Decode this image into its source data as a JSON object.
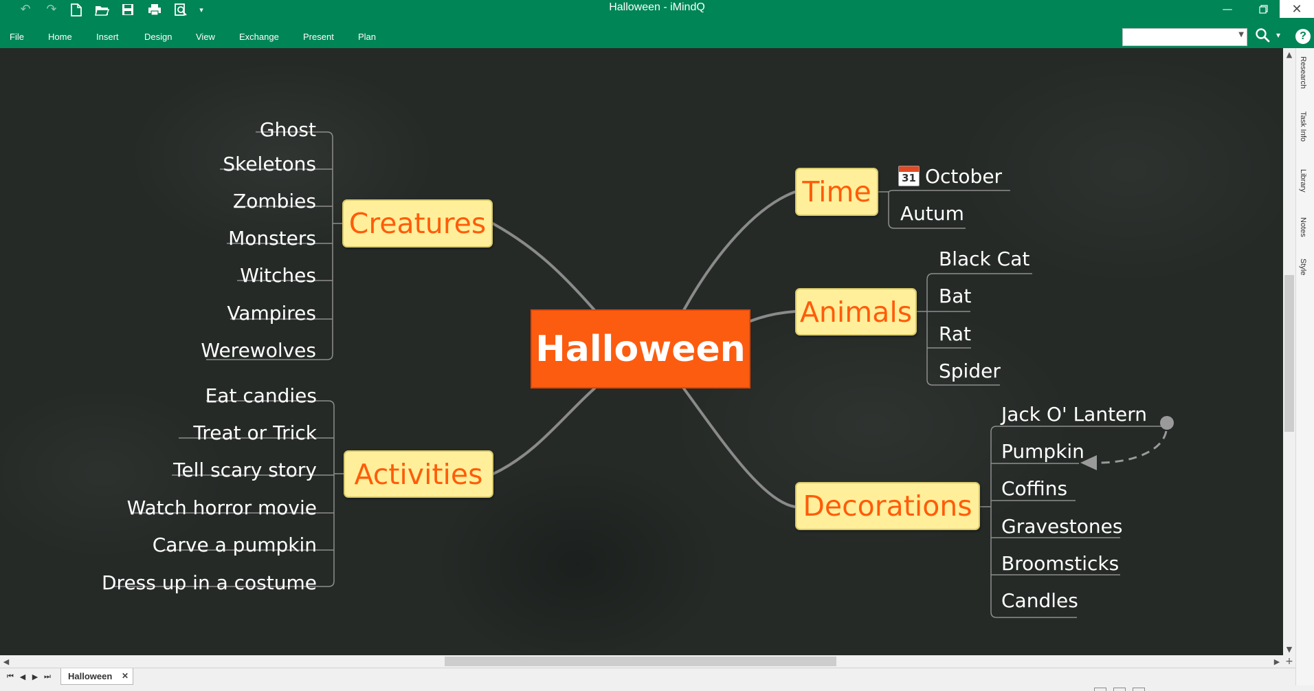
{
  "window": {
    "title": "Halloween - iMindQ"
  },
  "ribbon": {
    "tabs": [
      "File",
      "Home",
      "Insert",
      "Design",
      "View",
      "Exchange",
      "Present",
      "Plan"
    ]
  },
  "search": {
    "value": "",
    "placeholder": ""
  },
  "side_panel": {
    "tabs": [
      "Research",
      "Task Info",
      "Library",
      "Notes",
      "Style"
    ]
  },
  "map": {
    "central": "Halloween",
    "creatures": {
      "label": "Creatures",
      "items": [
        "Ghost",
        "Skeletons",
        "Zombies",
        "Monsters",
        "Witches",
        "Vampires",
        "Werewolves"
      ]
    },
    "activities": {
      "label": "Activities",
      "items": [
        "Eat candies",
        "Treat or Trick",
        "Tell scary story",
        "Watch horror movie",
        "Carve a pumpkin",
        "Dress up in a costume"
      ]
    },
    "time": {
      "label": "Time",
      "items": [
        "October",
        "Autum"
      ],
      "calendar_day": "31"
    },
    "animals": {
      "label": "Animals",
      "items": [
        "Black Cat",
        "Bat",
        "Rat",
        "Spider"
      ]
    },
    "decorations": {
      "label": "Decorations",
      "items": [
        "Jack O' Lantern",
        "Pumpkin",
        "Coffins",
        "Gravestones",
        "Broomsticks",
        "Candles"
      ]
    }
  },
  "sheets": {
    "active": "Halloween"
  },
  "colors": {
    "ribbon": "#008556",
    "central_node": "#fc5c10",
    "main_topic_fill": "#ffef9a",
    "main_topic_text": "#ff5c0a",
    "canvas": "#252a27"
  },
  "icons": [
    "undo-icon",
    "redo-icon",
    "new-file-icon",
    "open-folder-icon",
    "save-icon",
    "print-icon",
    "print-preview-icon",
    "calendar-icon",
    "search-icon",
    "help-icon"
  ]
}
